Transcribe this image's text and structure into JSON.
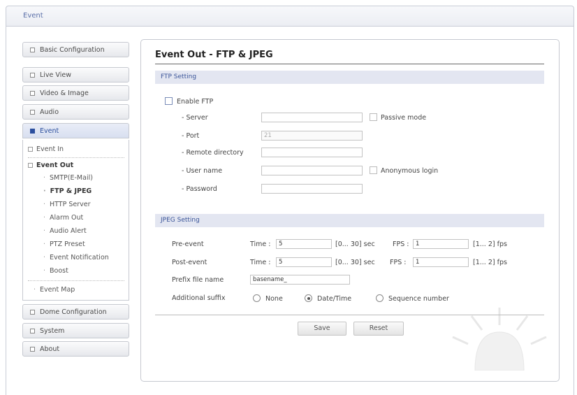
{
  "topbar": {
    "title": "Event"
  },
  "sidebar": {
    "items": [
      {
        "label": "Basic Configuration"
      },
      {
        "label": "Live View"
      },
      {
        "label": "Video & Image"
      },
      {
        "label": "Audio"
      },
      {
        "label": "Event"
      },
      {
        "label": "Dome Configuration"
      },
      {
        "label": "System"
      },
      {
        "label": "About"
      }
    ],
    "event_sub": {
      "event_in": "Event In",
      "event_out": "Event Out",
      "children": [
        "SMTP(E-Mail)",
        "FTP & JPEG",
        "HTTP Server",
        "Alarm Out",
        "Audio Alert",
        "PTZ Preset",
        "Event Notification",
        "Boost"
      ],
      "event_map": "Event Map"
    }
  },
  "page": {
    "title": "Event Out - FTP & JPEG"
  },
  "ftp": {
    "section": "FTP Setting",
    "enable_label": "Enable FTP",
    "server_label": "- Server",
    "server_value": "",
    "passive_label": "Passive mode",
    "port_label": "- Port",
    "port_value": "21",
    "remote_label": "- Remote directory",
    "remote_value": "",
    "user_label": "- User name",
    "user_value": "",
    "anon_label": "Anonymous login",
    "pass_label": "- Password",
    "pass_value": ""
  },
  "jpeg": {
    "section": "JPEG Setting",
    "pre_label": "Pre-event",
    "post_label": "Post-event",
    "time_label": "Time :",
    "fps_label": "FPS :",
    "pre_time": "5",
    "pre_fps": "1",
    "post_time": "5",
    "post_fps": "1",
    "time_range": "[0... 30] sec",
    "fps_range": "[1... 2] fps",
    "prefix_label": "Prefix file name",
    "prefix_value": "basename_",
    "suffix_label": "Additional suffix",
    "suffix_options": [
      "None",
      "Date/Time",
      "Sequence number"
    ],
    "suffix_selected": "Date/Time"
  },
  "buttons": {
    "save": "Save",
    "reset": "Reset"
  }
}
